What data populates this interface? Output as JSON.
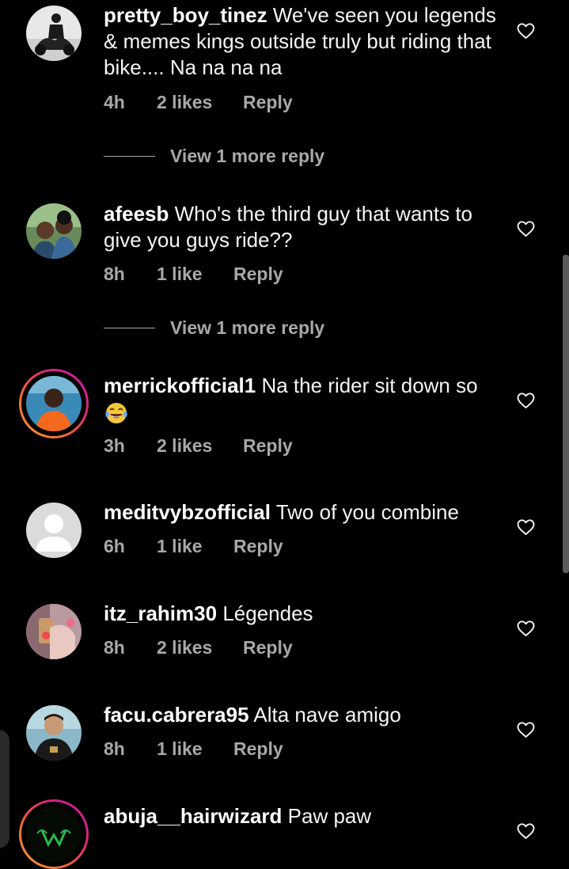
{
  "comments": [
    {
      "username": "pretty_boy_tinez",
      "text": "We've seen you legends & memes kings outside truly but riding that bike.... Na na na na",
      "time": "4h",
      "likes": "2 likes",
      "reply": "Reply",
      "view_more": "View 1 more reply"
    },
    {
      "username": "afeesb",
      "text": "Who's the third guy that wants to give you guys ride??",
      "time": "8h",
      "likes": "1 like",
      "reply": "Reply",
      "view_more": "View 1 more reply"
    },
    {
      "username": "merrickofficial1",
      "text": "Na the rider sit down so",
      "emoji": "face-with-tears-of-joy",
      "time": "3h",
      "likes": "2 likes",
      "reply": "Reply"
    },
    {
      "username": "meditvybzofficial",
      "text": "Two of you combine",
      "time": "6h",
      "likes": "1 like",
      "reply": "Reply"
    },
    {
      "username": "itz_rahim30",
      "text": "Légendes",
      "time": "8h",
      "likes": "2 likes",
      "reply": "Reply"
    },
    {
      "username": "facu.cabrera95",
      "text": "Alta nave amigo",
      "time": "8h",
      "likes": "1 like",
      "reply": "Reply"
    },
    {
      "username": "abuja__hairwizard",
      "text": "Paw paw"
    }
  ],
  "icons": {
    "like": "heart-outline-icon"
  },
  "colors": {
    "background": "#000000",
    "text": "#f5f5f5",
    "secondary_text": "#a8a8a8",
    "story_ring_start": "#f9a13a",
    "story_ring_end": "#c21cae"
  }
}
